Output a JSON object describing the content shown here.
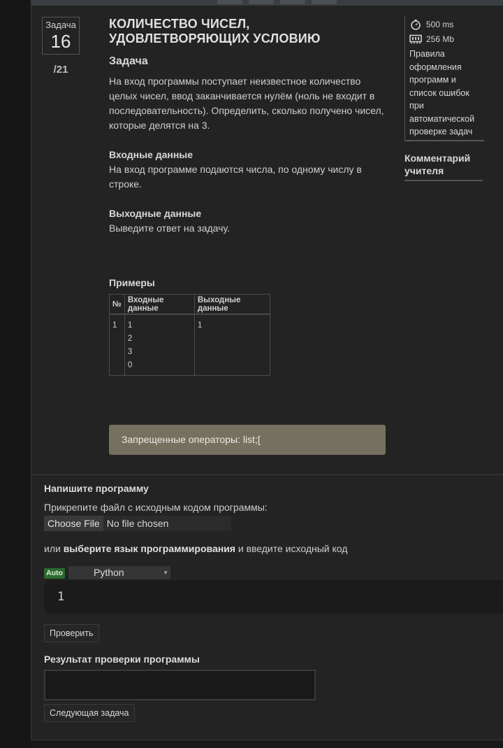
{
  "task": {
    "label": "Задача",
    "number": "16",
    "total": "/21"
  },
  "problem": {
    "title_line1": "КОЛИЧЕСТВО ЧИСЕЛ,",
    "title_line2": "УДОВЛЕТВОРЯЮЩИХ УСЛОВИЮ",
    "statement_heading": "Задача",
    "statement": "На вход программы поступает неизвестное количество целых чисел, ввод заканчивается нулём (ноль не входит в последовательность). Определить, сколько получено чисел, которые делятся на 3.",
    "input_heading": "Входные данные",
    "input_text": "На вход программе подаются числа, по одному числу в строке.",
    "output_heading": "Выходные данные",
    "output_text": "Выведите ответ на задачу.",
    "examples_heading": "Примеры",
    "examples": {
      "headers": [
        "№",
        "Входные данные",
        "Выходные данные"
      ],
      "rows": [
        {
          "num": "1",
          "input": [
            "1",
            "2",
            "3",
            "0"
          ],
          "output": "1"
        }
      ]
    },
    "forbidden": "Запрещенные операторы: list;["
  },
  "sidebar": {
    "time_limit": "500 ms",
    "memory_limit": "256 Mb",
    "rules_link": "Правила оформления программ и список ошибок при автоматической проверке задач",
    "teacher_comment": "Комментарий учителя",
    "icons": {
      "time": "stopwatch-icon",
      "memory": "memory-chip-icon"
    }
  },
  "submit": {
    "heading": "Напишите программу",
    "attach_label": "Прикрепите файл с исходным кодом программы:",
    "choose_file": "Choose File",
    "no_file": "No file chosen",
    "or_prefix": "или",
    "or_bold": "выберите язык программирования",
    "or_suffix": "и введите исходный код",
    "auto_badge": "Auto",
    "language": "Python",
    "editor_line": "1",
    "check_button": "Проверить",
    "result_heading": "Результат проверки программы",
    "next_button": "Следующая задача"
  },
  "colors": {
    "page_bg": "#181818",
    "panel_bg": "#232323",
    "forbidden_bg": "#75705f",
    "auto_badge_bg": "#2c6a30"
  }
}
